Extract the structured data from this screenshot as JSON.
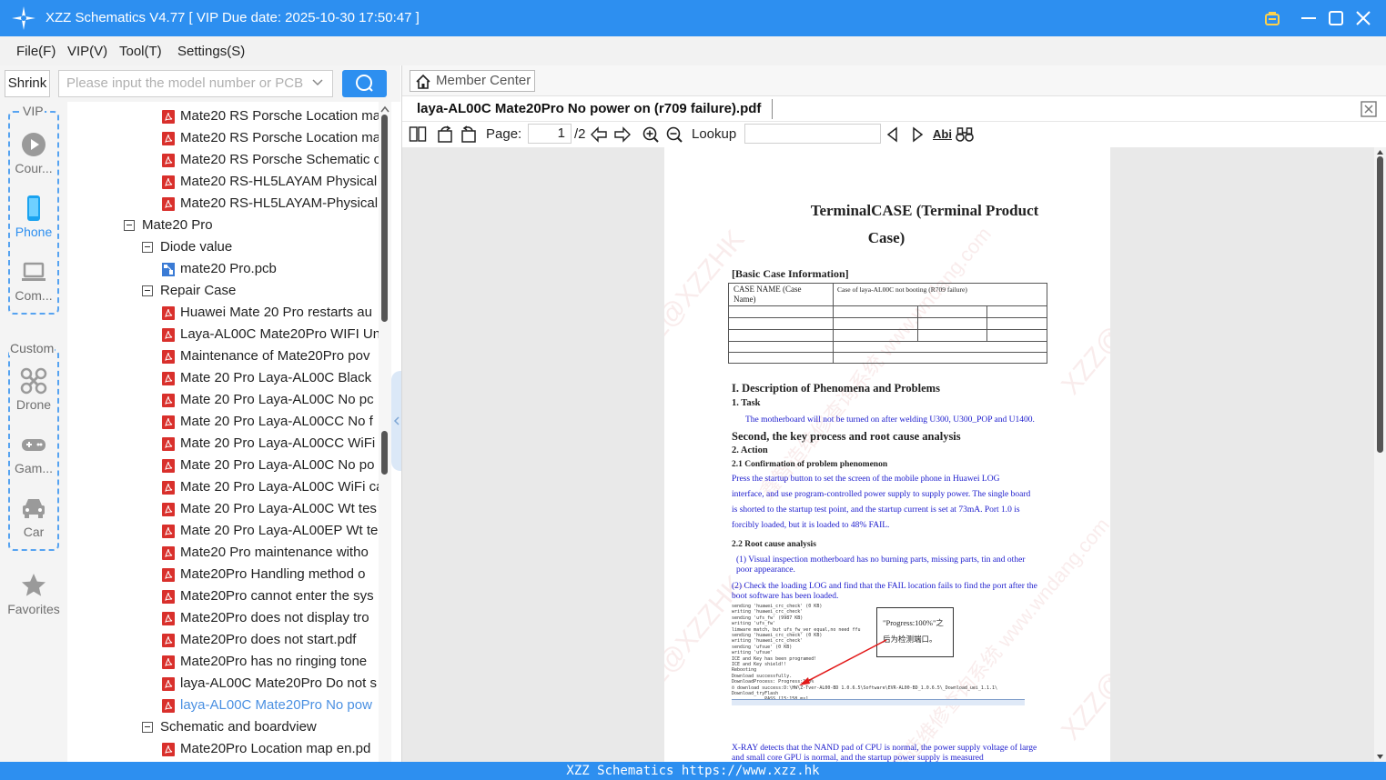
{
  "window": {
    "title": "XZZ Schematics V4.77 [ VIP Due date: 2025-10-30 17:50:47 ]"
  },
  "menu": [
    "File(F)",
    "VIP(V)",
    "Tool(T)",
    "Settings(S)"
  ],
  "left_toolbar": {
    "shrink_label": "Shrink",
    "search_placeholder": "Please input the model number or PCB"
  },
  "nav": {
    "vip_label": "VIP",
    "custom_label": "Custom",
    "items": [
      {
        "label": "Cour...",
        "icon": "play-circle-icon"
      },
      {
        "label": "Phone",
        "icon": "phone-icon"
      },
      {
        "label": "Com...",
        "icon": "laptop-icon"
      },
      {
        "label": "Drone",
        "icon": "drone-icon"
      },
      {
        "label": "Gam...",
        "icon": "gamepad-icon"
      },
      {
        "label": "Car",
        "icon": "car-icon"
      },
      {
        "label": "Favorites",
        "icon": "star-icon"
      }
    ]
  },
  "tree": [
    {
      "label": "Mate20 RS Porsche Location ma",
      "type": "pdf",
      "level": 2
    },
    {
      "label": "Mate20 RS Porsche Location ma",
      "type": "pdf",
      "level": 2
    },
    {
      "label": "Mate20 RS Porsche Schematic c",
      "type": "pdf",
      "level": 2
    },
    {
      "label": "Mate20 RS-HL5LAYAM Physical",
      "type": "pdf",
      "level": 2
    },
    {
      "label": "Mate20 RS-HL5LAYAM-Physical",
      "type": "pdf",
      "level": 2
    },
    {
      "label": "Mate20 Pro",
      "type": "folder",
      "level": 0
    },
    {
      "label": "Diode value",
      "type": "folder",
      "level": 1
    },
    {
      "label": "mate20 Pro.pcb",
      "type": "pcb",
      "level": 2
    },
    {
      "label": "Repair Case",
      "type": "folder",
      "level": 1
    },
    {
      "label": "Huawei Mate 20 Pro restarts au",
      "type": "pdf",
      "level": 2
    },
    {
      "label": "Laya-AL00C Mate20Pro WIFI Un",
      "type": "pdf",
      "level": 2
    },
    {
      "label": "Maintenance of Mate20Pro pov",
      "type": "pdf",
      "level": 2
    },
    {
      "label": "Mate 20 Pro  Laya-AL00C Black",
      "type": "pdf",
      "level": 2
    },
    {
      "label": "Mate 20 Pro  Laya-AL00C No pc",
      "type": "pdf",
      "level": 2
    },
    {
      "label": "Mate 20 Pro  Laya-AL00CC No f",
      "type": "pdf",
      "level": 2
    },
    {
      "label": "Mate 20 Pro  Laya-AL00CC WiFi",
      "type": "pdf",
      "level": 2
    },
    {
      "label": "Mate 20 Pro Laya-AL00C No po",
      "type": "pdf",
      "level": 2
    },
    {
      "label": "Mate 20 Pro Laya-AL00C WiFi ca",
      "type": "pdf",
      "level": 2
    },
    {
      "label": "Mate 20 Pro Laya-AL00C Wt tes",
      "type": "pdf",
      "level": 2
    },
    {
      "label": "Mate 20 Pro Laya-AL00EP Wt te",
      "type": "pdf",
      "level": 2
    },
    {
      "label": "Mate20 Pro maintenance witho",
      "type": "pdf",
      "level": 2
    },
    {
      "label": "Mate20Pro Handling method o",
      "type": "pdf",
      "level": 2
    },
    {
      "label": "Mate20Pro cannot enter the sys",
      "type": "pdf",
      "level": 2
    },
    {
      "label": "Mate20Pro does not display tro",
      "type": "pdf",
      "level": 2
    },
    {
      "label": "Mate20Pro does not start.pdf",
      "type": "pdf",
      "level": 2
    },
    {
      "label": "Mate20Pro has no ringing tone",
      "type": "pdf",
      "level": 2
    },
    {
      "label": "laya-AL00C Mate20Pro Do not s",
      "type": "pdf",
      "level": 2
    },
    {
      "label": "laya-AL00C Mate20Pro No pow",
      "type": "pdf",
      "level": 2,
      "selected": true
    },
    {
      "label": "Schematic and boardview",
      "type": "folder",
      "level": 1
    },
    {
      "label": "Mate20Pro Location map en.pd",
      "type": "pdf",
      "level": 2
    }
  ],
  "right_toolbar": {
    "member_center": "Member Center"
  },
  "document": {
    "tab_name": "laya-AL00C Mate20Pro No power on (r709 failure).pdf"
  },
  "viewer_toolbar": {
    "page_label": "Page:",
    "page_current": "1",
    "page_total": "/2",
    "lookup_label": "Lookup",
    "abi_label": "Abi"
  },
  "pdf": {
    "title_line1": "TerminalCASE (Terminal Product",
    "title_line2": "Case)",
    "basic_info": "[Basic Case Information]",
    "case_name_label_1": "CASE NAME (Case",
    "case_name_label_2": "Name)",
    "case_name_value": "Case of laya-AL00C not booting (R709 failure)",
    "section1": "I. Description of Phenomena and Problems",
    "task": "1. Task",
    "task_text": "The motherboard will not be turned on after welding U300, U300_POP and U1400.",
    "section2": "Second, the key process and root cause analysis",
    "action": "2. Action",
    "sub21": "2.1  Confirmation of problem phenomenon",
    "p21_1": "Press the startup button to set the screen of the mobile phone in Huawei LOG",
    "p21_2": "interface, and use program-controlled power supply to supply power. The single board",
    "p21_3": "is shorted to the startup test point, and the startup current is set at 73mA. Port 1.0 is",
    "p21_4": "forcibly loaded, but it is loaded to 48% FAIL.",
    "sub22": "2.2  Root cause analysis",
    "p22_1a": "(1) Visual inspection motherboard has no burning parts, missing parts, tin and other",
    "p22_1b": "poor appearance.",
    "p22_2a": "(2) Check the loading LOG and find that the FAIL location fails to find the port after the",
    "p22_2b": "boot software has been loaded.",
    "callout_1": "\"Progress:100%\"之",
    "callout_2": "后为检测端口。",
    "xray_1": "X-RAY detects that the NAND pad of CPU is normal, the power supply voltage of large",
    "xray_2": "and small core GPU is normal, and the startup power supply is measured",
    "log_lines": [
      "sending 'huawei_crc_check' (0 KB)",
      "writing 'huawei_crc_check'",
      "sending 'ufs_fw' (9987 KB)",
      "writing 'ufs_fw'",
      "limware match, but ufs_fw_ver equal,no need ffu",
      "sending 'huawei_crc_check' (0 KB)",
      "writing 'huawei_crc_check'",
      "sending 'ufsue' (0 KB)",
      "writing 'ufsue'",
      "ICE and Key has been programed!",
      "ICE and Key shield!!",
      "Rebooting",
      "Download successfully.",
      "DownloadProcess: Progress:100%",
      "ö download success:D:\\HW\\Z-Tver-AL00-BD 1.0.6.5\\Software\\EVR-AL00-BD_1.0.6.5\\_Download_uei_1.1.1\\",
      "       Download_tryFlash",
      "                     ............PASS [15:158 ms]"
    ],
    "watermark": "XZZ@XZZHK",
    "watermark2": "鑫智造维修查询系统 www.wndang.com"
  },
  "status_bar": "XZZ Schematics https://www.xzz.hk",
  "colors": {
    "accent": "#2d8ff0",
    "selected": "#4a90e2",
    "pdf_icon": "#d9302c",
    "pdf_blue_text": "#1a1acc"
  }
}
